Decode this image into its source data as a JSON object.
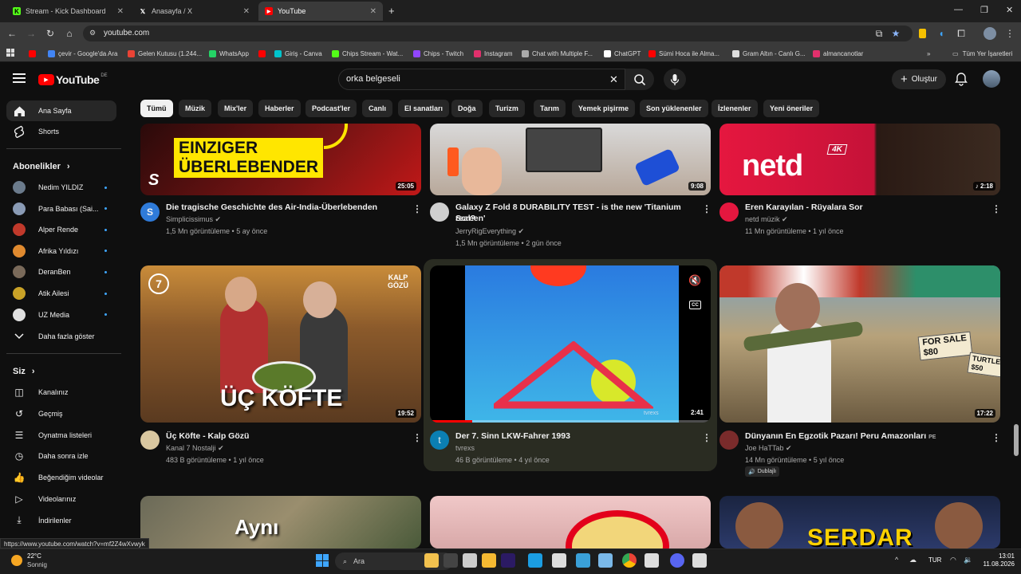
{
  "browser": {
    "tabs": [
      {
        "label": "Stream - Kick Dashboard",
        "icon": "kick-icon",
        "color": "#53fc18"
      },
      {
        "label": "Anasayfa / X",
        "icon": "x-icon",
        "color": "#ffffff"
      },
      {
        "label": "YouTube",
        "icon": "youtube-icon",
        "color": "#ff0000"
      }
    ],
    "url": "youtube.com",
    "bookmarks": [
      {
        "label": "",
        "color": "#ff0000"
      },
      {
        "label": "çevir - Google'da Ara",
        "color": "#4285f4"
      },
      {
        "label": "Gelen Kutusu (1.244...",
        "color": "#ea4335"
      },
      {
        "label": "WhatsApp",
        "color": "#25d366"
      },
      {
        "label": "",
        "color": "#ff0000"
      },
      {
        "label": "Giriş - Canva",
        "color": "#00c4cc"
      },
      {
        "label": "Chips Stream - Wat...",
        "color": "#53fc18"
      },
      {
        "label": "Chips - Twitch",
        "color": "#9146ff"
      },
      {
        "label": "Instagram",
        "color": "#e1306c"
      },
      {
        "label": "Chat with Multiple F...",
        "color": "#aaaaaa"
      },
      {
        "label": "ChatGPT",
        "color": "#ffffff"
      },
      {
        "label": "Sümi Hoca ile Alma...",
        "color": "#ff0000"
      },
      {
        "label": "Gram Altın - Canlı G...",
        "color": "#dddddd"
      },
      {
        "label": "almancanotlar",
        "color": "#e1306c"
      }
    ],
    "all_bookmarks": "Tüm Yer İşaretleri",
    "more_bookmarks": "»"
  },
  "header": {
    "logo": "YouTube",
    "region": "DE",
    "search_value": "orka belgeseli",
    "create_label": "Oluştur"
  },
  "sidebar": {
    "main": [
      {
        "label": "Ana Sayfa",
        "icon": "home-icon"
      },
      {
        "label": "Shorts",
        "icon": "shorts-icon"
      }
    ],
    "subs_title": "Abonelikler",
    "subs": [
      {
        "label": "Nedim YILDIZ",
        "color": "#6b7b8c"
      },
      {
        "label": "Para Babası (Sai...",
        "color": "#8a9bb5"
      },
      {
        "label": "Alper Rende",
        "color": "#c0392b"
      },
      {
        "label": "Afrika Yıldızı",
        "color": "#e08a2f"
      },
      {
        "label": "DeranBen",
        "color": "#7a6a5a"
      },
      {
        "label": "Atik Ailesi",
        "color": "#c9a227"
      },
      {
        "label": "UZ Media",
        "color": "#e0e0e0"
      }
    ],
    "show_more": "Daha fazla göster",
    "you_title": "Siz",
    "you_items": [
      {
        "label": "Kanalınız",
        "icon": "channel-icon"
      },
      {
        "label": "Geçmiş",
        "icon": "history-icon"
      },
      {
        "label": "Oynatma listeleri",
        "icon": "playlists-icon"
      },
      {
        "label": "Daha sonra izle",
        "icon": "watch-later-icon"
      },
      {
        "label": "Beğendiğim videolar",
        "icon": "like-icon"
      },
      {
        "label": "Videolarınız",
        "icon": "your-videos-icon"
      },
      {
        "label": "İndirilenler",
        "icon": "downloads-icon"
      }
    ]
  },
  "chips": [
    "Tümü",
    "Müzik",
    "Mix'ler",
    "Haberler",
    "Podcast'ler",
    "Canlı",
    "El sanatları",
    "Doğa",
    "Turizm",
    "Tarım",
    "Yemek pişirme",
    "Son yüklenenler",
    "İzlenenler",
    "Yeni öneriler"
  ],
  "videos": [
    {
      "title": "Die tragische Geschichte des Air-India-Überlebenden",
      "title2": "",
      "channel": "Simplicissimus",
      "verified": true,
      "meta": "1,5 Mn görüntüleme • 5 ay önce",
      "duration": "25:05",
      "thumb_text": "EINZIGER\nÜBERLEBENDER",
      "avatar": "S",
      "avatar_color": "#2f7bd9"
    },
    {
      "title": "Galaxy Z Fold 8 DURABILITY TEST - is the new 'Titanium Screen'",
      "title2": "real?",
      "channel": "JerryRigEverything",
      "verified": true,
      "meta": "1,5 Mn görüntüleme • 2 gün önce",
      "duration": "9:08",
      "thumb_text": "",
      "avatar": "",
      "avatar_color": "#cfcfcf"
    },
    {
      "title": "Eren Karayılan - Rüyalara Sor",
      "title2": "",
      "channel": "netd müzik",
      "verified": true,
      "meta": "11 Mn görüntüleme • 1 yıl önce",
      "duration": "♪ 2:18",
      "thumb_text": "netd",
      "badge": "4K",
      "avatar": "",
      "avatar_color": "#e5173f"
    },
    {
      "title": "Üç Köfte - Kalp Gözü",
      "title2": "",
      "channel": "Kanal 7 Nostalji",
      "verified": true,
      "meta": "483 B görüntüleme • 1 yıl önce",
      "duration": "19:52",
      "thumb_text": "ÜÇ KÖFTE",
      "corner_text": "KALP\nGÖZÜ",
      "avatar": "",
      "avatar_color": "#d9c7a0"
    },
    {
      "title": "Der 7. Sinn LKW-Fahrer 1993",
      "title2": "",
      "channel": "tvrexs",
      "verified": false,
      "meta": "46 B görüntüleme • 4 yıl önce",
      "duration": "2:41",
      "thumb_text": "tvrexs",
      "avatar": "t",
      "avatar_color": "#0b7fb3",
      "progress": 0.15
    },
    {
      "title": "Dünyanın En Egzotik Pazarı! Peru Amazonları",
      "title2": "",
      "title_suffix": "PE",
      "channel": "Joe HaTTab",
      "verified": true,
      "meta": "14 Mn görüntüleme • 5 yıl önce",
      "duration": "17:22",
      "dubbed": "Dublajlı",
      "thumb_text": "",
      "sign1": "FOR SALE\n$80",
      "sign2": "TURTLES\n$50",
      "avatar": "",
      "avatar_color": "#7a2b2b"
    }
  ],
  "bottom_row": [
    {
      "thumb_text": "Aynı"
    },
    {
      "thumb_text": ""
    },
    {
      "thumb_text": "SERDAR"
    }
  ],
  "status_url": "https://www.youtube.com/watch?v=mf2Z4wXvwyk",
  "taskbar": {
    "weather_temp": "22°C",
    "weather_text": "Sonnig",
    "search": "Ara",
    "lang": "TUR",
    "time": "13:01",
    "date": "11.08.2026"
  }
}
